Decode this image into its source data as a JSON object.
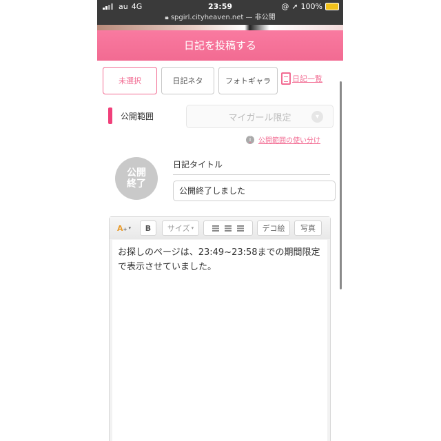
{
  "status_bar": {
    "carrier": "au",
    "network": "4G",
    "time": "23:59",
    "battery": "100%"
  },
  "url_bar": {
    "domain": "spgirl.cityheaven.net",
    "separator": "—",
    "privacy": "非公開"
  },
  "page_title": "日記を投稿する",
  "tabs": [
    "未選択",
    "日記ネタ",
    "フォトギャラ"
  ],
  "diary_list_link": "日記一覧",
  "scope": {
    "label": "公開範囲",
    "selected": "マイガール限定",
    "help_link": "公開範囲の使い分け"
  },
  "closed_badge": [
    "公開",
    "終了"
  ],
  "diary_title": {
    "label": "日記タイトル",
    "value": "公開終了しました"
  },
  "editor_toolbar": {
    "bold": "B",
    "size": "サイズ",
    "deco": "デコ絵",
    "photo": "写真"
  },
  "editor_body": "お探しのページは、23:49~23:58までの期間限定で表示させていました。",
  "colors": {
    "accent": "#f26b92",
    "marker": "#f0407a"
  }
}
